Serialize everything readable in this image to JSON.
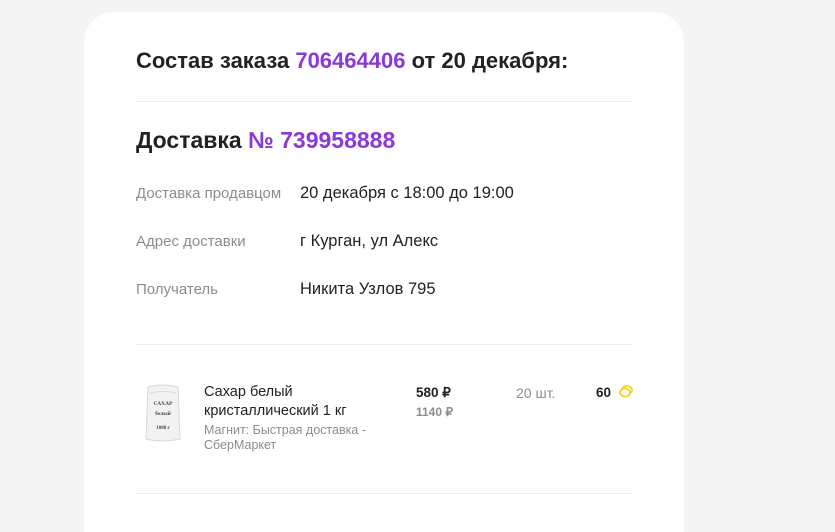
{
  "order": {
    "title_prefix": "Состав заказа",
    "number": "706464406",
    "title_suffix": "от 20 декабря:"
  },
  "delivery": {
    "title_prefix": "Доставка",
    "number": "№ 739958888",
    "rows": [
      {
        "label": "Доставка продавцом",
        "value": "20 декабря с 18:00 до 19:00"
      },
      {
        "label": "Адрес доставки",
        "value": "г Курган, ул Алекс"
      },
      {
        "label": "Получатель",
        "value": "Никита Узлов 795"
      }
    ]
  },
  "product": {
    "name": "Сахар белый кристаллический 1 кг",
    "seller": "Магнит: Быстрая доставка - СберМаркет",
    "image_text": [
      "САХАР",
      "белый",
      "1000 г"
    ],
    "price": "580 ₽",
    "old_price": "1140 ₽",
    "quantity": "20 шт.",
    "bonus": "60",
    "bonus_icon": "coin-icon"
  },
  "colors": {
    "accent": "#8a38d6",
    "bonus_icon": "#f5d21e"
  }
}
